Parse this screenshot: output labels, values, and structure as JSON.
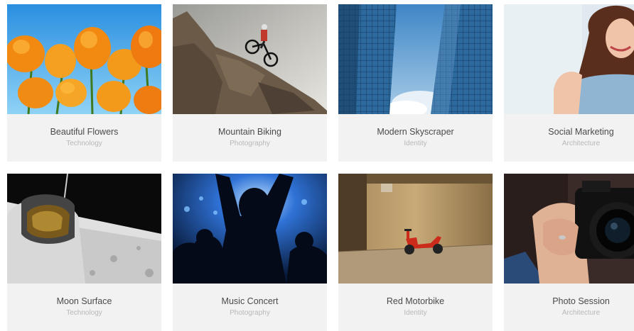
{
  "portfolio": {
    "items": [
      {
        "title": "Beautiful Flowers",
        "category": "Technology",
        "image": "orange-poppies-blue-sky-photo"
      },
      {
        "title": "Mountain Biking",
        "category": "Photography",
        "image": "cyclist-jumping-rock-photo"
      },
      {
        "title": "Modern Skyscraper",
        "category": "Identity",
        "image": "glass-skyscrapers-looking-up-photo"
      },
      {
        "title": "Social Marketing",
        "category": "Architecture",
        "image": "smiling-woman-denim-shirt-photo"
      },
      {
        "title": "Moon Surface",
        "category": "Technology",
        "image": "astronaut-on-moon-photo"
      },
      {
        "title": "Music Concert",
        "category": "Photography",
        "image": "concert-crowd-stage-lights-photo"
      },
      {
        "title": "Red Motorbike",
        "category": "Identity",
        "image": "red-scooter-alley-photo"
      },
      {
        "title": "Photo Session",
        "category": "Architecture",
        "image": "woman-holding-camera-photo"
      }
    ]
  }
}
